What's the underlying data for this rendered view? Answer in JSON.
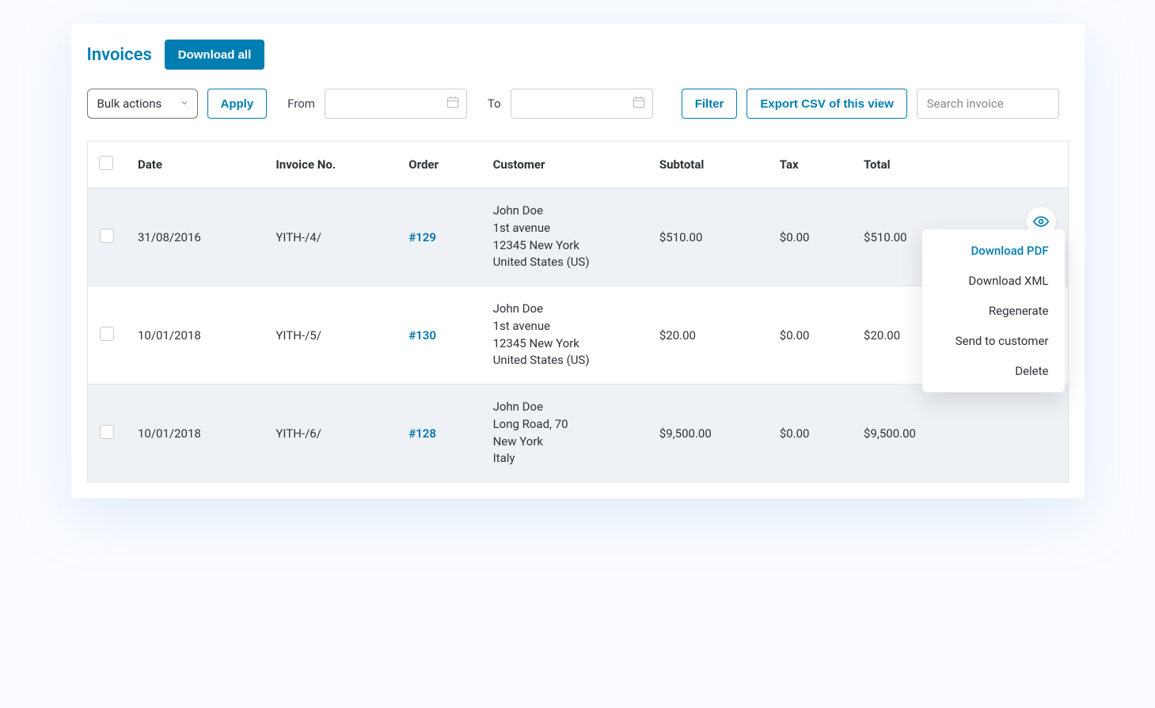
{
  "header": {
    "title": "Invoices",
    "download_all": "Download all"
  },
  "toolbar": {
    "bulk_actions_label": "Bulk actions",
    "apply": "Apply",
    "from": "From",
    "to": "To",
    "filter": "Filter",
    "export_csv": "Export CSV of this view",
    "search_placeholder": "Search invoice"
  },
  "columns": {
    "date": "Date",
    "invoice_no": "Invoice No.",
    "order": "Order",
    "customer": "Customer",
    "subtotal": "Subtotal",
    "tax": "Tax",
    "total": "Total"
  },
  "rows": [
    {
      "date": "31/08/2016",
      "invoice_no": "YITH-/4/",
      "order": "#129",
      "customer": [
        "John Doe",
        "1st avenue",
        "12345 New York",
        "United States (US)"
      ],
      "subtotal": "$510.00",
      "tax": "$0.00",
      "total": "$510.00",
      "show_actions": true
    },
    {
      "date": "10/01/2018",
      "invoice_no": "YITH-/5/",
      "order": "#130",
      "customer": [
        "John Doe",
        "1st avenue",
        "12345 New York",
        "United States (US)"
      ],
      "subtotal": "$20.00",
      "tax": "$0.00",
      "total": "$20.00",
      "show_actions": false
    },
    {
      "date": "10/01/2018",
      "invoice_no": "YITH-/6/",
      "order": "#128",
      "customer": [
        "John Doe",
        "Long Road, 70",
        "New York",
        "Italy"
      ],
      "subtotal": "$9,500.00",
      "tax": "$0.00",
      "total": "$9,500.00",
      "show_actions": false
    }
  ],
  "row_menu": {
    "download_pdf": "Download PDF",
    "download_xml": "Download XML",
    "regenerate": "Regenerate",
    "send_to_customer": "Send to customer",
    "delete": "Delete"
  }
}
